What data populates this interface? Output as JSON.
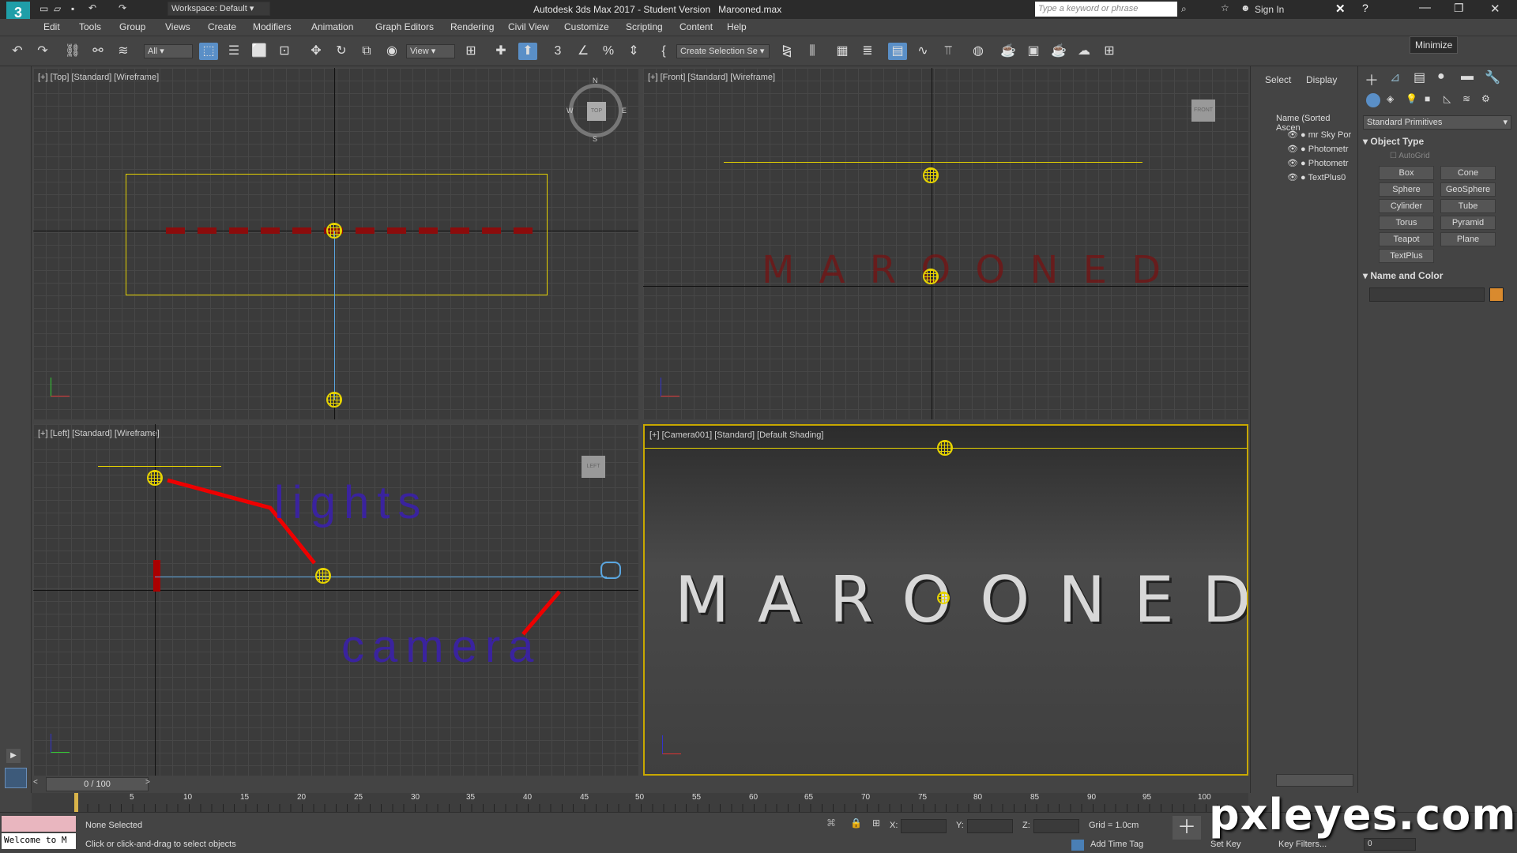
{
  "window": {
    "title": "Autodesk 3ds Max 2017 - Student Version",
    "filename": "Marooned.max",
    "workspace": "Workspace: Default",
    "search_placeholder": "Type a keyword or phrase",
    "sign_in": "Sign In",
    "tooltip": "Minimize"
  },
  "menu": [
    "Edit",
    "Tools",
    "Group",
    "Views",
    "Create",
    "Modifiers",
    "Animation",
    "Graph Editors",
    "Rendering",
    "Civil View",
    "Customize",
    "Scripting",
    "Content",
    "Help"
  ],
  "toolbar": {
    "filter": "All",
    "view": "View",
    "selection_set": "Create Selection Se"
  },
  "viewports": {
    "top": "[+] [Top] [Standard] [Wireframe]",
    "front": "[+] [Front] [Standard] [Wireframe]",
    "left": "[+] [Left] [Standard] [Wireframe]",
    "camera": "[+] [Camera001] [Standard] [Default Shading]",
    "front_text": "M A R O O N E D",
    "camera_text": "MAROONED",
    "annotation_lights": "lights",
    "annotation_camera": "camera",
    "viewcube_top": "TOP",
    "viewcube_front": "FRONT",
    "viewcube_left": "LEFT",
    "compass_n": "N",
    "compass_s": "S",
    "compass_e": "E",
    "compass_w": "W"
  },
  "scene_explorer": {
    "tabs": [
      "Select",
      "Display"
    ],
    "header": "Name (Sorted Ascen",
    "items": [
      "mr Sky Por",
      "Photometr",
      "Photometr",
      "TextPlus0"
    ]
  },
  "command_panel": {
    "category": "Standard Primitives",
    "object_type": "Object Type",
    "autogrid": "AutoGrid",
    "buttons": [
      "Box",
      "Cone",
      "Sphere",
      "GeoSphere",
      "Cylinder",
      "Tube",
      "Torus",
      "Pyramid",
      "Teapot",
      "Plane",
      "TextPlus"
    ],
    "name_and_color": "Name and Color",
    "color_swatch": "#d98a2e"
  },
  "timeline": {
    "frame": "0 / 100",
    "ticks": [
      "5",
      "10",
      "15",
      "20",
      "25",
      "30",
      "35",
      "40",
      "45",
      "50",
      "55",
      "60",
      "65",
      "70",
      "75",
      "80",
      "85",
      "90",
      "95",
      "100"
    ]
  },
  "status": {
    "maxscript": "Welcome to M",
    "selected": "None Selected",
    "prompt": "Click or click-and-drag to select objects",
    "x_label": "X:",
    "y_label": "Y:",
    "z_label": "Z:",
    "grid": "Grid = 1.0cm",
    "add_time_tag": "Add Time Tag",
    "set_key": "Set Key",
    "key_filters": "Key Filters...",
    "frame_field": "0"
  },
  "watermark": "pxleyes.com"
}
